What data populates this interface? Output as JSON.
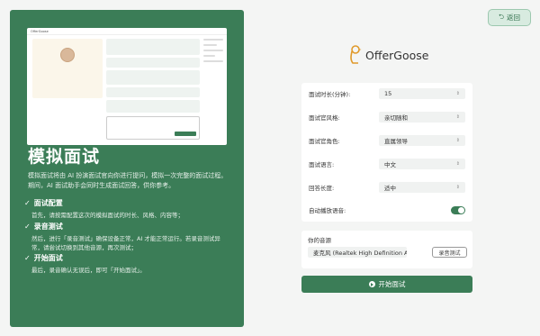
{
  "back_label": "返回",
  "logo_text": "OfferGoose",
  "intro": {
    "title": "模拟面试",
    "description": "模拟面试将由 AI 扮演面试官向你进行提问，模拟一次完整的面试过程。期间，AI 面试助手会同时生成面试回答，供你参考。",
    "steps": [
      {
        "heading": "面试配置",
        "body": "首先，请按需配置这次的模拟面试的时长、风格、内容等；"
      },
      {
        "heading": "录音测试",
        "body": "然后，进行「录音测试」确保设备正常，AI 才能正常运行。若录音测试异常，请尝试切换到其他音源，再次测试；"
      },
      {
        "heading": "开始面试",
        "body": "最后，录音确认无误后，即可「开始面试」。"
      }
    ]
  },
  "settings": [
    {
      "label": "面试时长(分钟):",
      "value": "15"
    },
    {
      "label": "面试官风格:",
      "value": "亲切随和"
    },
    {
      "label": "面试官角色:",
      "value": "直属领导"
    },
    {
      "label": "面试语言:",
      "value": "中文"
    },
    {
      "label": "回答长度:",
      "value": "适中"
    }
  ],
  "auto_play_label": "自动播放语音:",
  "auto_play_on": true,
  "audio": {
    "label": "你的音源",
    "device": "麦克风 (Realtek High Definition Audio)",
    "test_button": "录音测试"
  },
  "start_button": "开始面试",
  "colors": {
    "brand": "#3b7d57",
    "accent": "#d8ebe0"
  }
}
